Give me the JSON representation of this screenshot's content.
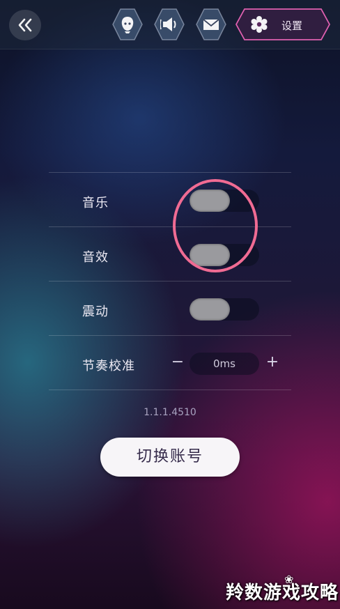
{
  "header": {
    "back_icon": "double-chevron-left-icon",
    "buttons": [
      {
        "name": "face-icon"
      },
      {
        "name": "speaker-icon"
      },
      {
        "name": "mail-icon"
      }
    ],
    "settings_label": "设置",
    "settings_icon": "gear-icon"
  },
  "settings": {
    "music_label": "音乐",
    "sfx_label": "音效",
    "vibration_label": "震动",
    "calibration_label": "节奏校准",
    "calibration_value": "0ms",
    "minus_label": "−",
    "plus_label": "+"
  },
  "version": "1.1.1.4510",
  "switch_account_label": "切换账号",
  "watermark_text": "羚数游戏攻略",
  "colors": {
    "accent_pink": "#f06b93",
    "settings_border": "#e060b0",
    "toggle_knob": "#9a9a9e"
  }
}
